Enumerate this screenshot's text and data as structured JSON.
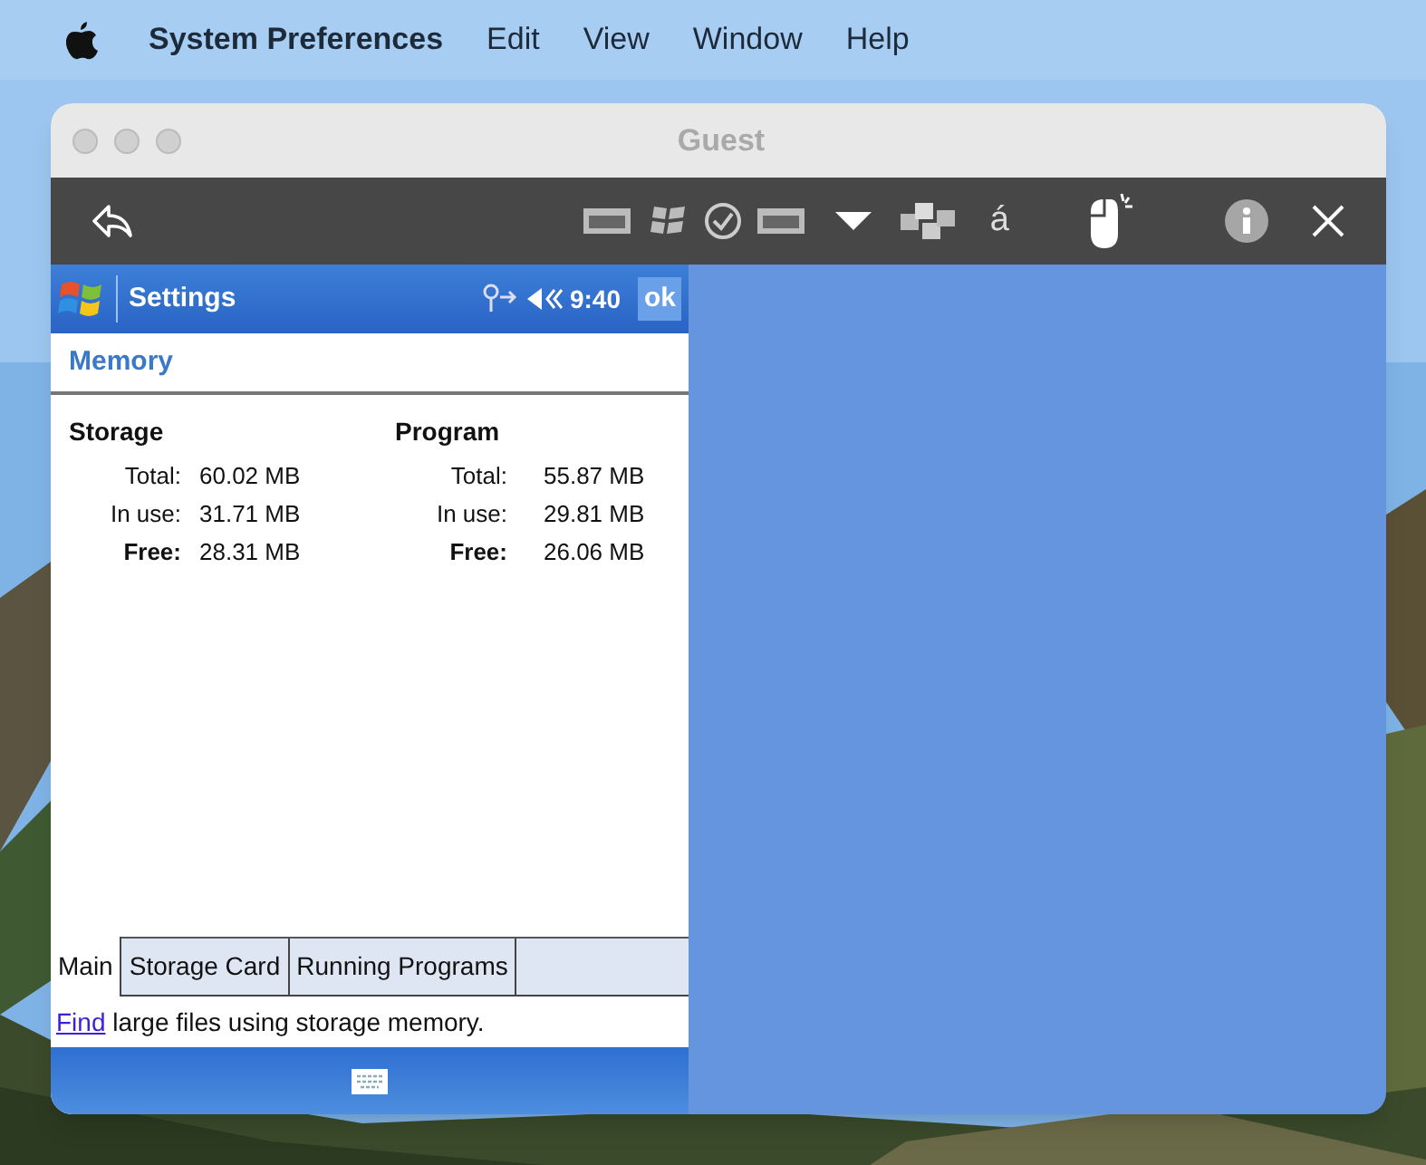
{
  "menu_bar": {
    "app": "System Preferences",
    "items": [
      "Edit",
      "View",
      "Window",
      "Help"
    ]
  },
  "window": {
    "title": "Guest"
  },
  "toolbar": {
    "accent_key": "á"
  },
  "device": {
    "title": "Settings",
    "time": "9:40",
    "ok": "ok",
    "header": "Memory",
    "sections": [
      {
        "title": "Storage",
        "rows": [
          {
            "label": "Total:",
            "value": "60.02 MB",
            "bold": false
          },
          {
            "label": "In use:",
            "value": "31.71 MB",
            "bold": false
          },
          {
            "label": "Free:",
            "value": "28.31 MB",
            "bold": true
          }
        ]
      },
      {
        "title": "Program",
        "rows": [
          {
            "label": "Total:",
            "value": "55.87 MB",
            "bold": false
          },
          {
            "label": "In use:",
            "value": "29.81 MB",
            "bold": false
          },
          {
            "label": "Free:",
            "value": "26.06 MB",
            "bold": true
          }
        ]
      }
    ],
    "tabs": [
      {
        "label": "Main",
        "selected": true
      },
      {
        "label": "Storage Card",
        "selected": false
      },
      {
        "label": "Running Programs",
        "selected": false
      }
    ],
    "hint": {
      "link": "Find",
      "text": " large files using storage memory."
    }
  }
}
